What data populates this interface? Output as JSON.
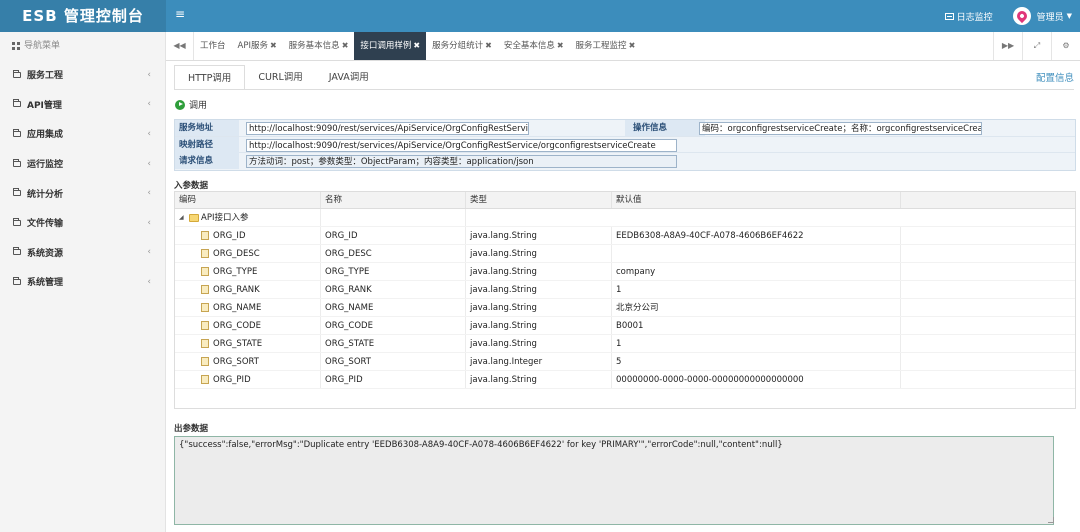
{
  "app": {
    "title": "ESB 管理控制台"
  },
  "topbar": {
    "log_label": "日志监控",
    "user_label": "管理员"
  },
  "sidebar": {
    "title": "导航菜单",
    "items": [
      {
        "label": "服务工程"
      },
      {
        "label": "API管理"
      },
      {
        "label": "应用集成"
      },
      {
        "label": "运行监控"
      },
      {
        "label": "统计分析"
      },
      {
        "label": "文件传输"
      },
      {
        "label": "系统资源"
      },
      {
        "label": "系统管理"
      }
    ]
  },
  "tabs": [
    {
      "label": "工作台",
      "closable": false
    },
    {
      "label": "API服务",
      "closable": true
    },
    {
      "label": "服务基本信息",
      "closable": true
    },
    {
      "label": "接口调用样例",
      "closable": true,
      "active": true
    },
    {
      "label": "服务分组统计",
      "closable": true
    },
    {
      "label": "安全基本信息",
      "closable": true
    },
    {
      "label": "服务工程监控",
      "closable": true
    }
  ],
  "subtabs": [
    {
      "label": "HTTP调用"
    },
    {
      "label": "CURL调用"
    },
    {
      "label": "JAVA调用"
    }
  ],
  "config_link": "配置信息",
  "invoke_label": "调用",
  "info": {
    "service_address_label": "服务地址",
    "service_address": "http://localhost:9090/rest/services/ApiService/OrgConfigRestService",
    "op_info_label": "操作信息",
    "op_info": "编码：orgconfigrestserviceCreate；名称：orgconfigrestserviceCreate",
    "map_path_label": "映射路径",
    "map_path": "http://localhost:9090/rest/services/ApiService/OrgConfigRestService/orgconfigrestserviceCreate",
    "request_label": "请求信息",
    "request": "方法动词：post；参数类型：ObjectParam；内容类型：application/json"
  },
  "input_section": "入参数据",
  "grid": {
    "headers": [
      "编码",
      "名称",
      "类型",
      "默认值"
    ],
    "root": "API接口入参",
    "rows": [
      {
        "code": "ORG_ID",
        "name": "ORG_ID",
        "type": "java.lang.String",
        "default": "EEDB6308-A8A9-40CF-A078-4606B6EF4622"
      },
      {
        "code": "ORG_DESC",
        "name": "ORG_DESC",
        "type": "java.lang.String",
        "default": ""
      },
      {
        "code": "ORG_TYPE",
        "name": "ORG_TYPE",
        "type": "java.lang.String",
        "default": "company"
      },
      {
        "code": "ORG_RANK",
        "name": "ORG_RANK",
        "type": "java.lang.String",
        "default": "1"
      },
      {
        "code": "ORG_NAME",
        "name": "ORG_NAME",
        "type": "java.lang.String",
        "default": "北京分公司"
      },
      {
        "code": "ORG_CODE",
        "name": "ORG_CODE",
        "type": "java.lang.String",
        "default": "B0001"
      },
      {
        "code": "ORG_STATE",
        "name": "ORG_STATE",
        "type": "java.lang.String",
        "default": "1"
      },
      {
        "code": "ORG_SORT",
        "name": "ORG_SORT",
        "type": "java.lang.Integer",
        "default": "5"
      },
      {
        "code": "ORG_PID",
        "name": "ORG_PID",
        "type": "java.lang.String",
        "default": "00000000-0000-0000-00000000000000000"
      }
    ]
  },
  "output_section": "出参数据",
  "output": "{\"success\":false,\"errorMsg\":\"Duplicate entry 'EEDB6308-A8A9-40CF-A078-4606B6EF4622' for key 'PRIMARY'\",\"errorCode\":null,\"content\":null}"
}
